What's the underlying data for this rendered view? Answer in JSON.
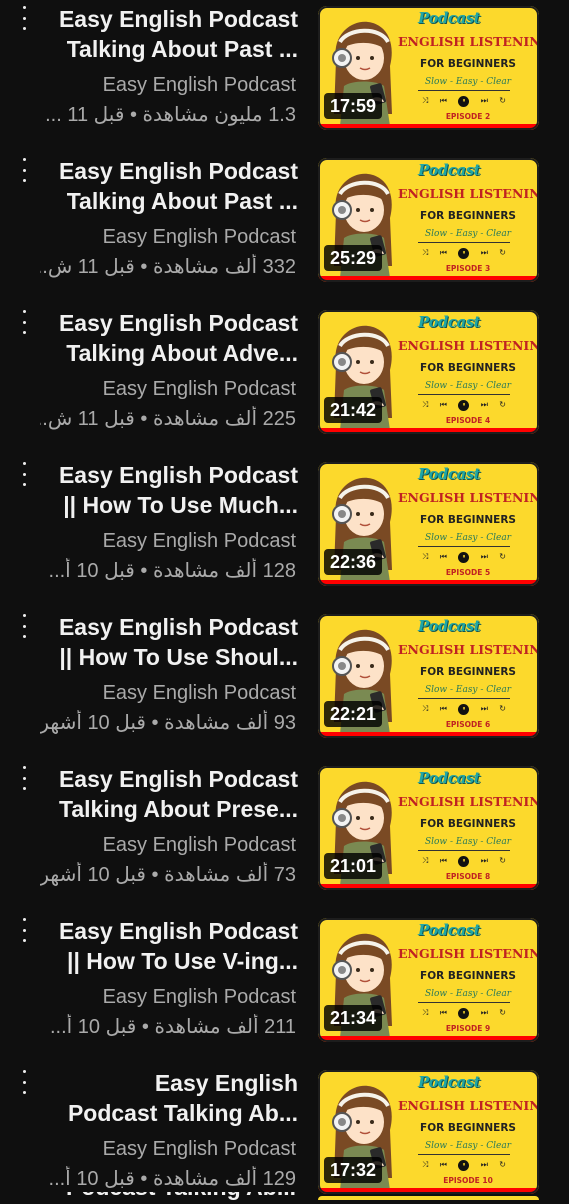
{
  "thumbnail": {
    "logo": "Podcast",
    "heading": "ENGLISH LISTENING",
    "subheading": "FOR BEGINNERS",
    "tagline": "Slow - Easy - Clear",
    "controls": [
      "⤨",
      "⏮",
      "⏸",
      "⏭",
      "↻"
    ],
    "colors": {
      "background": "#fcd92c",
      "heading": "#c02222",
      "logo": "#1fa6a6",
      "progress": "#ff0000"
    }
  },
  "videos": [
    {
      "title_line1": "Easy English Podcast",
      "title_line2": "Talking About Past ...",
      "channel": "Easy English Podcast",
      "meta": "1.3 مليون مشاهدة • قبل 11 ...",
      "duration": "17:59",
      "episode": "EPISODE 2"
    },
    {
      "title_line1": "Easy English Podcast",
      "title_line2": "Talking About Past ...",
      "channel": "Easy English Podcast",
      "meta": "332 ألف مشاهدة • قبل 11 ش...",
      "duration": "25:29",
      "episode": "EPISODE 3"
    },
    {
      "title_line1": "Easy English Podcast",
      "title_line2": "Talking About Adve...",
      "channel": "Easy English Podcast",
      "meta": "225 ألف مشاهدة • قبل 11 ش...",
      "duration": "21:42",
      "episode": "EPISODE 4"
    },
    {
      "title_line1": "Easy English Podcast",
      "title_line2": "|| How To Use Much...",
      "channel": "Easy English Podcast",
      "meta": "128 ألف مشاهدة • قبل 10 أ...",
      "duration": "22:36",
      "episode": "EPISODE 5"
    },
    {
      "title_line1": "Easy English Podcast",
      "title_line2": "|| How To Use Shoul...",
      "channel": "Easy English Podcast",
      "meta": "93 ألف مشاهدة • قبل 10 أشهر",
      "duration": "22:21",
      "episode": "EPISODE 6"
    },
    {
      "title_line1": "Easy English Podcast",
      "title_line2": "Talking About Prese...",
      "channel": "Easy English Podcast",
      "meta": "73 ألف مشاهدة • قبل 10 أشهر",
      "duration": "21:01",
      "episode": "EPISODE 8"
    },
    {
      "title_line1": "Easy English Podcast",
      "title_line2": "|| How To Use V-ing...",
      "channel": "Easy English Podcast",
      "meta": "211 ألف مشاهدة • قبل 10 أ...",
      "duration": "21:34",
      "episode": "EPISODE 9"
    },
    {
      "title_line1": "Easy English",
      "title_line2": "Podcast Talking Ab...",
      "channel": "Easy English Podcast",
      "meta": "129 ألف مشاهدة • قبل 10 أ...",
      "duration": "17:32",
      "episode": "EPISODE 10"
    }
  ],
  "next_peek_title": "Podcast Talking Ab..."
}
